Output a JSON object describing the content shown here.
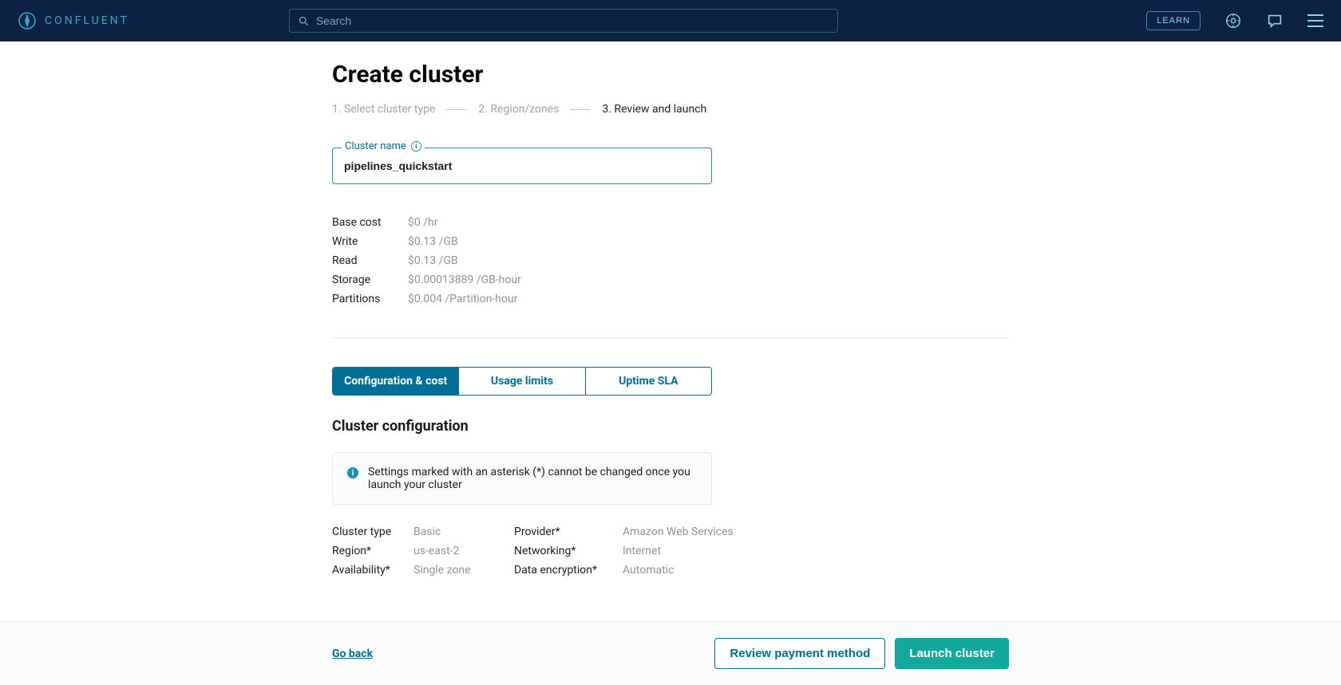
{
  "header": {
    "brand": "CONFLUENT",
    "search_placeholder": "Search",
    "learn_label": "LEARN"
  },
  "page": {
    "title": "Create cluster",
    "steps": {
      "s1": "1. Select cluster type",
      "s2": "2. Region/zones",
      "s3": "3. Review and launch"
    },
    "cluster_name_label": "Cluster name",
    "cluster_name_value": "pipelines_quickstart"
  },
  "costs": [
    {
      "k": "Base cost",
      "v": "$0 /hr"
    },
    {
      "k": "Write",
      "v": "$0.13 /GB"
    },
    {
      "k": "Read",
      "v": "$0.13 /GB"
    },
    {
      "k": "Storage",
      "v": "$0.00013889 /GB-hour"
    },
    {
      "k": "Partitions",
      "v": "$0.004 /Partition-hour"
    }
  ],
  "tabs": {
    "t0": "Configuration & cost",
    "t1": "Usage limits",
    "t2": "Uptime SLA"
  },
  "section": {
    "title": "Cluster configuration",
    "notice": "Settings marked with an asterisk (*) cannot be changed once you launch your cluster"
  },
  "config": {
    "left": [
      {
        "k": "Cluster type",
        "v": "Basic"
      },
      {
        "k": "Region*",
        "v": "us-east-2"
      },
      {
        "k": "Availability*",
        "v": "Single zone"
      }
    ],
    "right": [
      {
        "k": "Provider*",
        "v": "Amazon Web Services"
      },
      {
        "k": "Networking*",
        "v": "Internet"
      },
      {
        "k": "Data encryption*",
        "v": "Automatic"
      }
    ]
  },
  "footer": {
    "go_back": "Go back",
    "review": "Review payment method",
    "launch": "Launch cluster"
  }
}
